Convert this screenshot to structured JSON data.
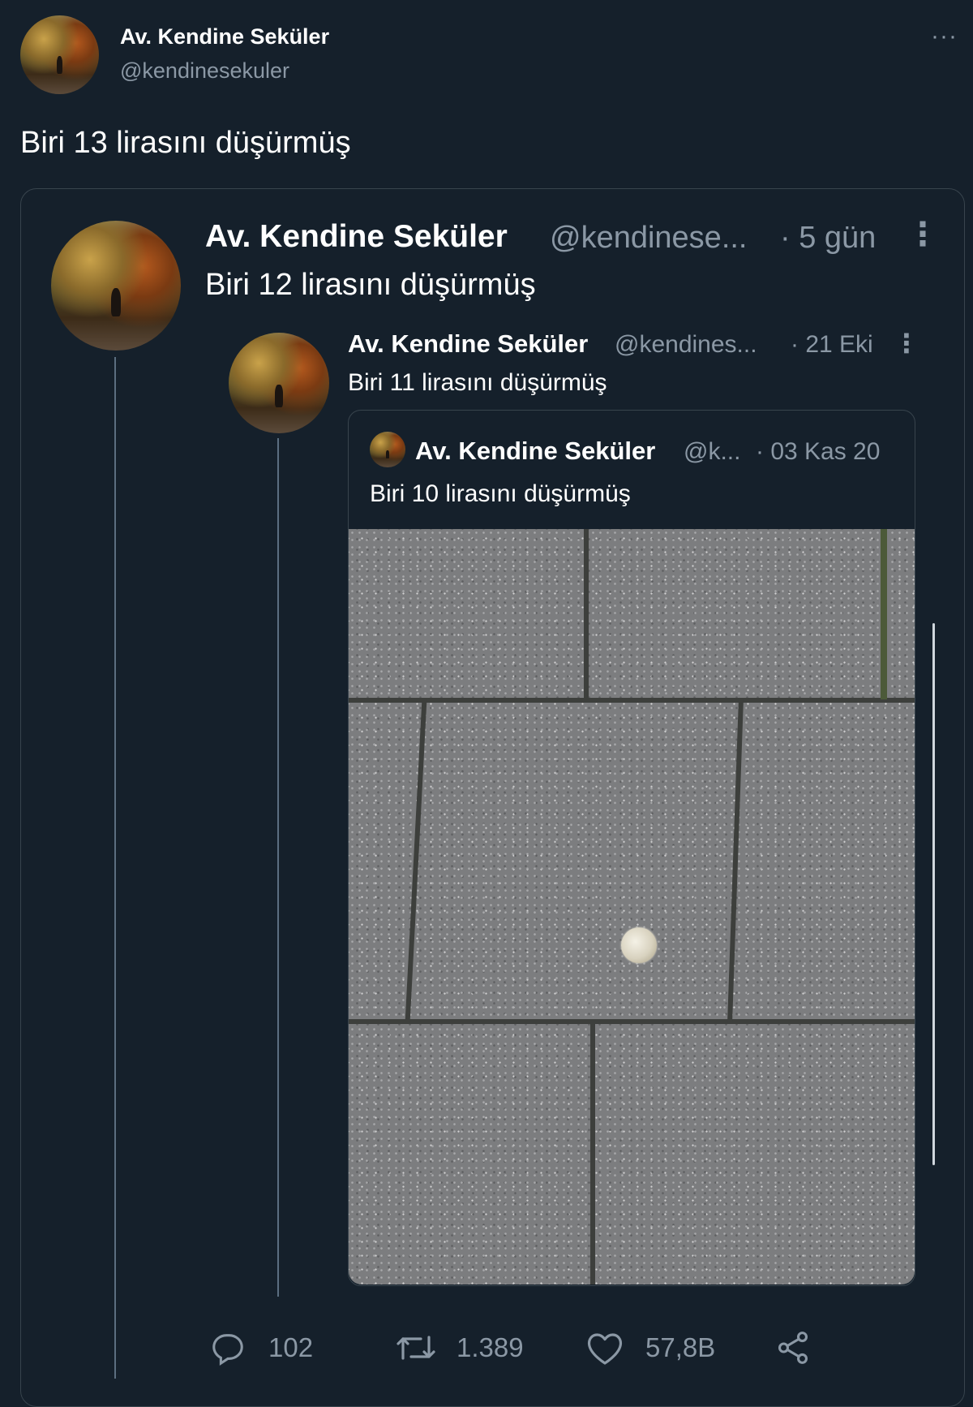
{
  "tweet": {
    "author_name": "Av. Kendine Seküler",
    "author_handle": "@kendinesekuler",
    "more_label": "···",
    "text": "Biri 13 lirasını düşürmüş"
  },
  "quote1": {
    "author_name": "Av. Kendine Seküler",
    "author_handle": "@kendinese...",
    "time": "· 5 gün",
    "more_label": "⋮",
    "text": "Biri 12 lirasını düşürmüş"
  },
  "quote2": {
    "author_name": "Av. Kendine Seküler",
    "author_handle": "@kendines...",
    "time": "· 21 Eki",
    "more_label": "⋮",
    "text": "Biri 11 lirasını düşürmüş"
  },
  "quote3": {
    "author_name": "Av. Kendine Seküler",
    "author_handle": "@k...",
    "time": "· 03 Kas 20",
    "text": "Biri 10 lirasını düşürmüş"
  },
  "actions": {
    "reply_count": "102",
    "retweet_count": "1.389",
    "like_count": "57,8B"
  },
  "icons": {
    "reply": "reply-icon",
    "retweet": "retweet-icon",
    "like": "like-icon",
    "share": "share-icon"
  },
  "colors": {
    "background": "#15202b",
    "text": "#ffffff",
    "muted": "#8b98a5",
    "border": "#38444d"
  }
}
